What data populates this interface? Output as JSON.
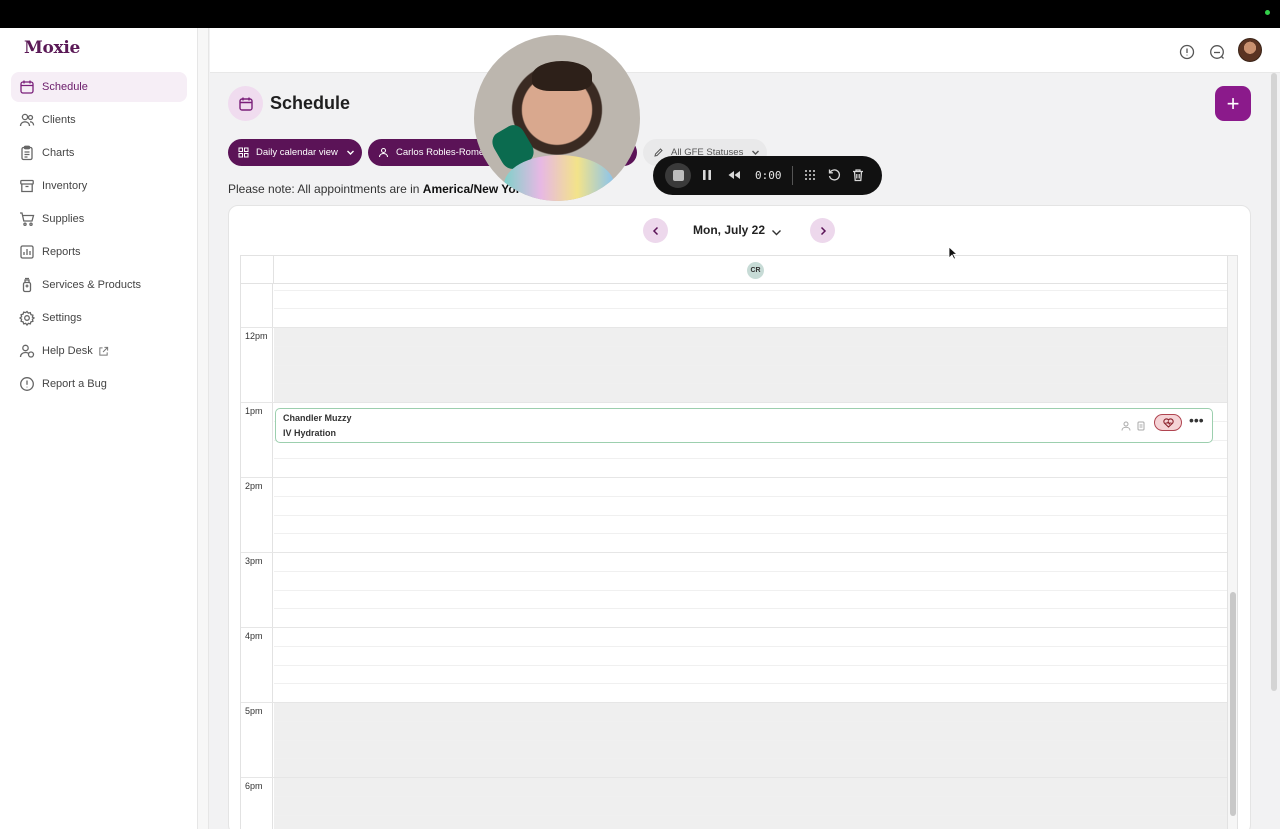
{
  "app": {
    "logo": "Moxie"
  },
  "sidebar": {
    "items": [
      {
        "label": "Schedule",
        "icon": "calendar-icon",
        "active": true
      },
      {
        "label": "Clients",
        "icon": "users-icon"
      },
      {
        "label": "Charts",
        "icon": "clipboard-icon"
      },
      {
        "label": "Inventory",
        "icon": "archive-icon"
      },
      {
        "label": "Supplies",
        "icon": "cart-icon"
      },
      {
        "label": "Reports",
        "icon": "bar-chart-icon"
      },
      {
        "label": "Services & Products",
        "icon": "bottle-icon"
      },
      {
        "label": "Settings",
        "icon": "gear-icon"
      },
      {
        "label": "Help Desk",
        "icon": "help-person-icon",
        "external": true
      },
      {
        "label": "Report a Bug",
        "icon": "alert-circle-icon"
      }
    ]
  },
  "header": {
    "icons": [
      "info-icon",
      "chat-icon",
      "user-avatar"
    ]
  },
  "page": {
    "title": "Schedule",
    "add_button": "+"
  },
  "filters": {
    "view": "Daily calendar view",
    "provider": "Carlos Robles-Rome",
    "statuses": "All GFE Statuses"
  },
  "note": {
    "prefix": "Please note: All appointments are in ",
    "timezone": "America/New Yor"
  },
  "calendar": {
    "date": "Mon, July 22",
    "provider_initials": "CR",
    "times": [
      "12pm",
      "1pm",
      "2pm",
      "3pm",
      "4pm",
      "5pm",
      "6pm"
    ],
    "appointment": {
      "client": "Chandler Muzzy",
      "service": "IV Hydration"
    }
  },
  "recorder": {
    "time": "0:00",
    "controls": [
      "stop-icon",
      "pause-icon",
      "rewind-icon",
      "grid-icon",
      "restart-icon",
      "trash-icon"
    ]
  },
  "colors": {
    "brand": "#5b1357",
    "accent": "#8b1a8b",
    "appointment_border": "#9ccfae"
  }
}
